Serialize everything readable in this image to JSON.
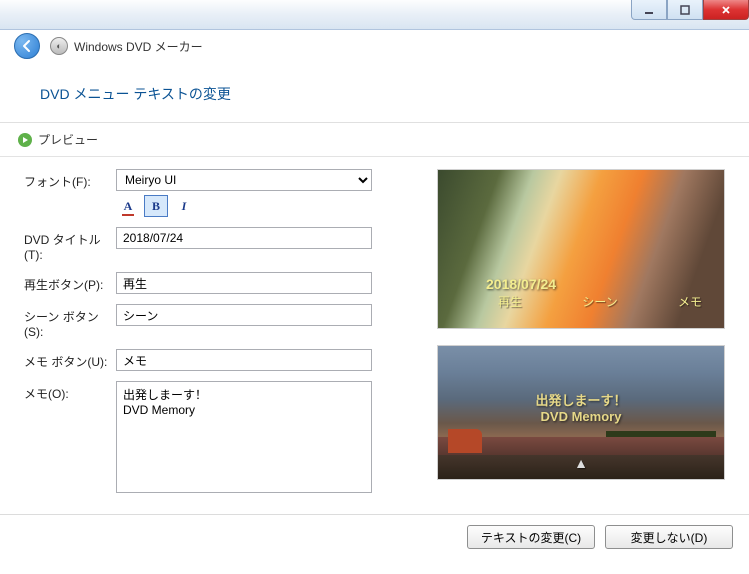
{
  "app": {
    "title": "Windows DVD メーカー"
  },
  "section": {
    "title": "DVD メニュー テキストの変更"
  },
  "preview_bar": {
    "label": "プレビュー"
  },
  "form": {
    "font": {
      "label": "フォント(F):",
      "value": "Meiryo UI"
    },
    "dvd_title": {
      "label": "DVD タイトル(T):",
      "value": "2018/07/24"
    },
    "play_btn": {
      "label": "再生ボタン(P):",
      "value": "再生"
    },
    "scene_btn": {
      "label": "シーン ボタン(S):",
      "value": "シーン"
    },
    "memo_btn": {
      "label": "メモ ボタン(U):",
      "value": "メモ"
    },
    "memo": {
      "label": "メモ(O):",
      "value": "出発しまーす！\nDVD Memory"
    }
  },
  "preview": {
    "main_title": "2018/07/24",
    "menu_items": [
      "再生",
      "シーン",
      "メモ"
    ],
    "memo_text": "出発しまーす！\nDVD Memory"
  },
  "footer": {
    "change": "テキストの変更(C)",
    "nochange": "変更しない(D)"
  }
}
